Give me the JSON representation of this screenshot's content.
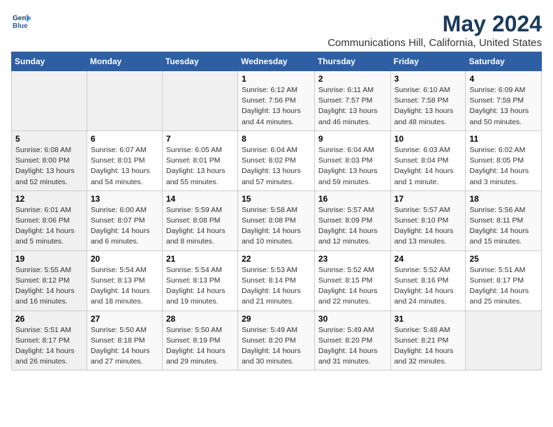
{
  "logo": {
    "line1": "General",
    "line2": "Blue"
  },
  "title": "May 2024",
  "subtitle": "Communications Hill, California, United States",
  "days_header": [
    "Sunday",
    "Monday",
    "Tuesday",
    "Wednesday",
    "Thursday",
    "Friday",
    "Saturday"
  ],
  "weeks": [
    [
      {
        "num": "",
        "info": ""
      },
      {
        "num": "",
        "info": ""
      },
      {
        "num": "",
        "info": ""
      },
      {
        "num": "1",
        "info": "Sunrise: 6:12 AM\nSunset: 7:56 PM\nDaylight: 13 hours\nand 44 minutes."
      },
      {
        "num": "2",
        "info": "Sunrise: 6:11 AM\nSunset: 7:57 PM\nDaylight: 13 hours\nand 46 minutes."
      },
      {
        "num": "3",
        "info": "Sunrise: 6:10 AM\nSunset: 7:58 PM\nDaylight: 13 hours\nand 48 minutes."
      },
      {
        "num": "4",
        "info": "Sunrise: 6:09 AM\nSunset: 7:59 PM\nDaylight: 13 hours\nand 50 minutes."
      }
    ],
    [
      {
        "num": "5",
        "info": "Sunrise: 6:08 AM\nSunset: 8:00 PM\nDaylight: 13 hours\nand 52 minutes."
      },
      {
        "num": "6",
        "info": "Sunrise: 6:07 AM\nSunset: 8:01 PM\nDaylight: 13 hours\nand 54 minutes."
      },
      {
        "num": "7",
        "info": "Sunrise: 6:05 AM\nSunset: 8:01 PM\nDaylight: 13 hours\nand 55 minutes."
      },
      {
        "num": "8",
        "info": "Sunrise: 6:04 AM\nSunset: 8:02 PM\nDaylight: 13 hours\nand 57 minutes."
      },
      {
        "num": "9",
        "info": "Sunrise: 6:04 AM\nSunset: 8:03 PM\nDaylight: 13 hours\nand 59 minutes."
      },
      {
        "num": "10",
        "info": "Sunrise: 6:03 AM\nSunset: 8:04 PM\nDaylight: 14 hours\nand 1 minute."
      },
      {
        "num": "11",
        "info": "Sunrise: 6:02 AM\nSunset: 8:05 PM\nDaylight: 14 hours\nand 3 minutes."
      }
    ],
    [
      {
        "num": "12",
        "info": "Sunrise: 6:01 AM\nSunset: 8:06 PM\nDaylight: 14 hours\nand 5 minutes."
      },
      {
        "num": "13",
        "info": "Sunrise: 6:00 AM\nSunset: 8:07 PM\nDaylight: 14 hours\nand 6 minutes."
      },
      {
        "num": "14",
        "info": "Sunrise: 5:59 AM\nSunset: 8:08 PM\nDaylight: 14 hours\nand 8 minutes."
      },
      {
        "num": "15",
        "info": "Sunrise: 5:58 AM\nSunset: 8:08 PM\nDaylight: 14 hours\nand 10 minutes."
      },
      {
        "num": "16",
        "info": "Sunrise: 5:57 AM\nSunset: 8:09 PM\nDaylight: 14 hours\nand 12 minutes."
      },
      {
        "num": "17",
        "info": "Sunrise: 5:57 AM\nSunset: 8:10 PM\nDaylight: 14 hours\nand 13 minutes."
      },
      {
        "num": "18",
        "info": "Sunrise: 5:56 AM\nSunset: 8:11 PM\nDaylight: 14 hours\nand 15 minutes."
      }
    ],
    [
      {
        "num": "19",
        "info": "Sunrise: 5:55 AM\nSunset: 8:12 PM\nDaylight: 14 hours\nand 16 minutes."
      },
      {
        "num": "20",
        "info": "Sunrise: 5:54 AM\nSunset: 8:13 PM\nDaylight: 14 hours\nand 18 minutes."
      },
      {
        "num": "21",
        "info": "Sunrise: 5:54 AM\nSunset: 8:13 PM\nDaylight: 14 hours\nand 19 minutes."
      },
      {
        "num": "22",
        "info": "Sunrise: 5:53 AM\nSunset: 8:14 PM\nDaylight: 14 hours\nand 21 minutes."
      },
      {
        "num": "23",
        "info": "Sunrise: 5:52 AM\nSunset: 8:15 PM\nDaylight: 14 hours\nand 22 minutes."
      },
      {
        "num": "24",
        "info": "Sunrise: 5:52 AM\nSunset: 8:16 PM\nDaylight: 14 hours\nand 24 minutes."
      },
      {
        "num": "25",
        "info": "Sunrise: 5:51 AM\nSunset: 8:17 PM\nDaylight: 14 hours\nand 25 minutes."
      }
    ],
    [
      {
        "num": "26",
        "info": "Sunrise: 5:51 AM\nSunset: 8:17 PM\nDaylight: 14 hours\nand 26 minutes."
      },
      {
        "num": "27",
        "info": "Sunrise: 5:50 AM\nSunset: 8:18 PM\nDaylight: 14 hours\nand 27 minutes."
      },
      {
        "num": "28",
        "info": "Sunrise: 5:50 AM\nSunset: 8:19 PM\nDaylight: 14 hours\nand 29 minutes."
      },
      {
        "num": "29",
        "info": "Sunrise: 5:49 AM\nSunset: 8:20 PM\nDaylight: 14 hours\nand 30 minutes."
      },
      {
        "num": "30",
        "info": "Sunrise: 5:49 AM\nSunset: 8:20 PM\nDaylight: 14 hours\nand 31 minutes."
      },
      {
        "num": "31",
        "info": "Sunrise: 5:48 AM\nSunset: 8:21 PM\nDaylight: 14 hours\nand 32 minutes."
      },
      {
        "num": "",
        "info": ""
      }
    ]
  ]
}
